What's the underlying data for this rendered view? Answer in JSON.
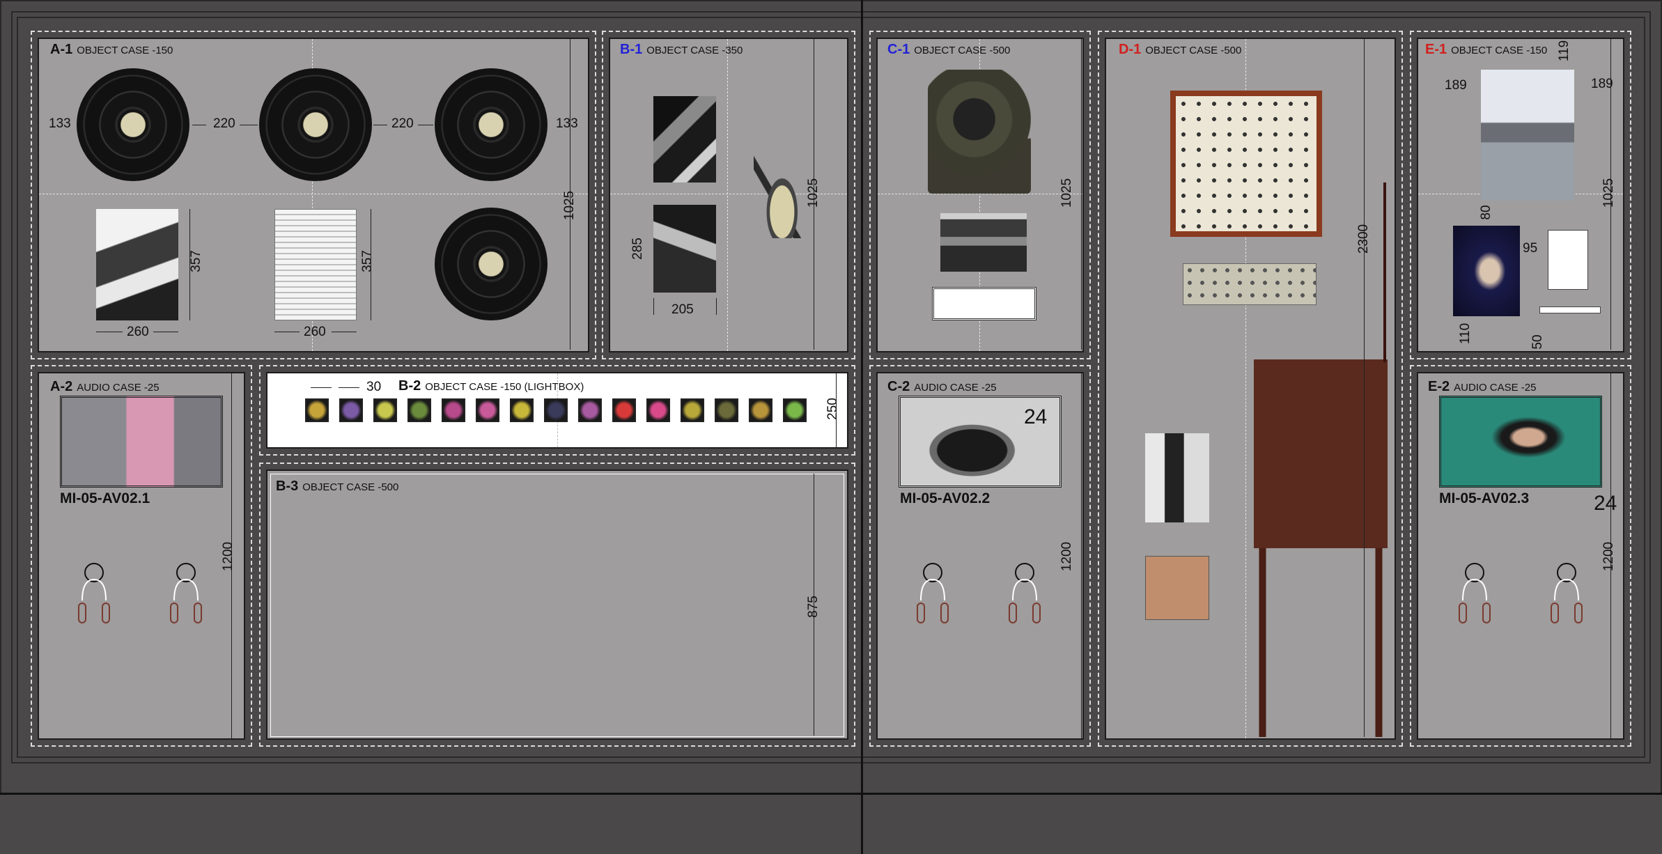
{
  "cases": {
    "a1": {
      "code": "A-1",
      "type": "OBJECT CASE -150",
      "code_color": "#111111",
      "dims": {
        "left": "133",
        "gap1": "220",
        "gap2": "220",
        "right": "133",
        "height": "1025",
        "ph1_h": "357",
        "ph2_h": "357",
        "ph1_w": "260",
        "ph2_w": "260"
      }
    },
    "b1": {
      "code": "B-1",
      "type": "OBJECT CASE -350",
      "code_color": "#2323d6",
      "dims": {
        "height": "1025",
        "ph_h": "285",
        "ph_w": "205"
      }
    },
    "c1": {
      "code": "C-1",
      "type": "OBJECT CASE -500",
      "code_color": "#2323d6",
      "dims": {
        "height": "1025"
      }
    },
    "d1": {
      "code": "D-1",
      "type": "OBJECT CASE -500",
      "code_color": "#d21f1f",
      "dims": {
        "height": "2300"
      }
    },
    "e1": {
      "code": "E-1",
      "type": "OBJECT CASE -150",
      "code_color": "#d21f1f",
      "dims": {
        "top": "119",
        "left": "189",
        "right": "189",
        "height": "1025",
        "ph_h": "80",
        "ph_b": "110",
        "gap": "95",
        "bottom": "50"
      }
    },
    "a2": {
      "code": "A-2",
      "type": "AUDIO CASE -25",
      "code_color": "#111111",
      "label": "MI-05-AV02.1",
      "dims": {
        "height": "1200"
      }
    },
    "b2": {
      "code": "B-2",
      "type": "OBJECT CASE -150 (LIGHTBOX)",
      "code_color": "#111111",
      "dims": {
        "gap": "30",
        "height": "250"
      }
    },
    "b3": {
      "code": "B-3",
      "type": "OBJECT CASE -500",
      "code_color": "#111111",
      "dims": {
        "height": "875"
      }
    },
    "c2": {
      "code": "C-2",
      "type": "AUDIO CASE -25",
      "code_color": "#111111",
      "label": "MI-05-AV02.2",
      "overlay": "24",
      "dims": {
        "height": "1200"
      }
    },
    "e2": {
      "code": "E-2",
      "type": "AUDIO CASE -25",
      "code_color": "#111111",
      "label": "MI-05-AV02.3",
      "overlay": "24",
      "dims": {
        "height": "1200"
      }
    }
  },
  "slide_colors": [
    "#c7a43a",
    "#7b5aa6",
    "#c8c84e",
    "#6a8a3c",
    "#b74a8a",
    "#c85a9a",
    "#c8b83a",
    "#3a3a5a",
    "#a85aa0",
    "#d83a3a",
    "#d84a8a",
    "#b8a83a",
    "#6a6a3a",
    "#b8943a",
    "#7ab84a"
  ]
}
